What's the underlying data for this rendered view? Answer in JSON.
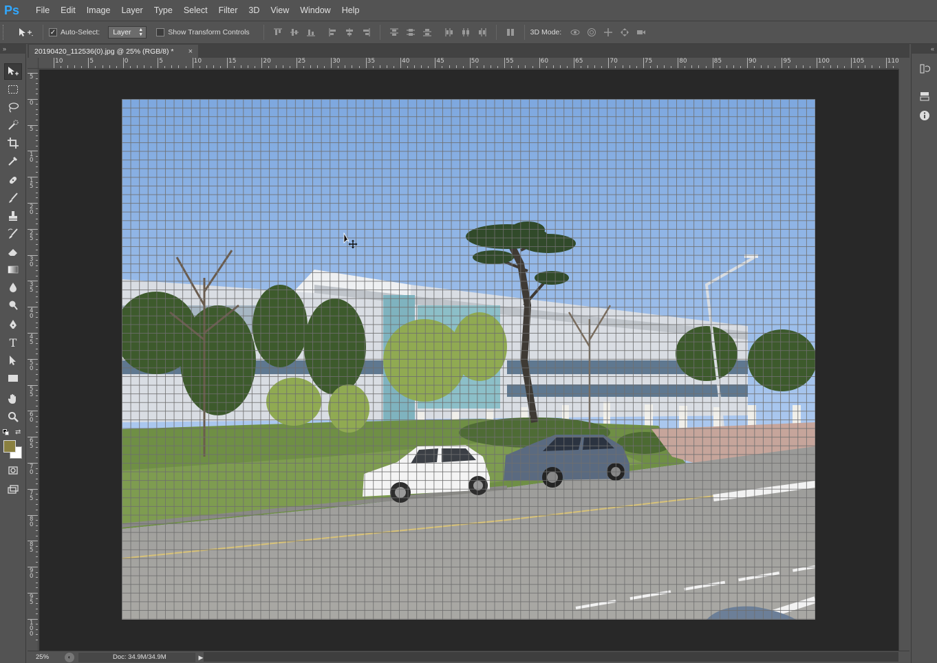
{
  "app": {
    "logo": "Ps",
    "accent": "#31a8ff"
  },
  "menu": [
    "File",
    "Edit",
    "Image",
    "Layer",
    "Type",
    "Select",
    "Filter",
    "3D",
    "View",
    "Window",
    "Help"
  ],
  "options": {
    "auto_select_label": "Auto-Select:",
    "auto_select_checked": true,
    "auto_select_value": "Layer",
    "show_transform_label": "Show Transform Controls",
    "show_transform_checked": false,
    "mode_3d_label": "3D Mode:"
  },
  "panels": {
    "collapse_left": "»",
    "collapse_right": "«"
  },
  "document": {
    "tab_title": "20190420_112536(0).jpg @ 25% (RGB/8) *",
    "close_glyph": "×"
  },
  "rulers": {
    "top_labels": [
      "10",
      "5",
      "0",
      "5",
      "10",
      "15",
      "20",
      "25",
      "30",
      "35",
      "40",
      "45",
      "50",
      "55",
      "60",
      "65",
      "70",
      "75",
      "80",
      "85",
      "90",
      "95",
      "100",
      "105",
      "110"
    ],
    "left_labels": [
      "5",
      "0",
      "5",
      "1 0",
      "1 5",
      "2 0",
      "2 5",
      "3 0",
      "3 5",
      "4 0",
      "4 5",
      "5 0",
      "5 5",
      "6 0",
      "6 5",
      "7 0",
      "7 5",
      "8 0",
      "8 5",
      "9 0",
      "9 5",
      "1 0 0"
    ]
  },
  "status": {
    "zoom": "25%",
    "doc_info": "Doc: 34.9M/34.9M",
    "arrow": "▶"
  },
  "colors": {
    "foreground": "#8a8040",
    "background": "#ffffff",
    "ui_bg": "#535353",
    "pasteboard": "#282828"
  },
  "tools": [
    "move-tool",
    "marquee-tool",
    "lasso-tool",
    "quick-select-tool",
    "crop-tool",
    "eyedropper-tool",
    "healing-brush-tool",
    "brush-tool",
    "clone-stamp-tool",
    "history-brush-tool",
    "eraser-tool",
    "gradient-tool",
    "blur-tool",
    "dodge-tool",
    "pen-tool",
    "type-tool",
    "path-select-tool",
    "rectangle-tool",
    "hand-tool",
    "zoom-tool"
  ],
  "type_tool_glyph": "T"
}
